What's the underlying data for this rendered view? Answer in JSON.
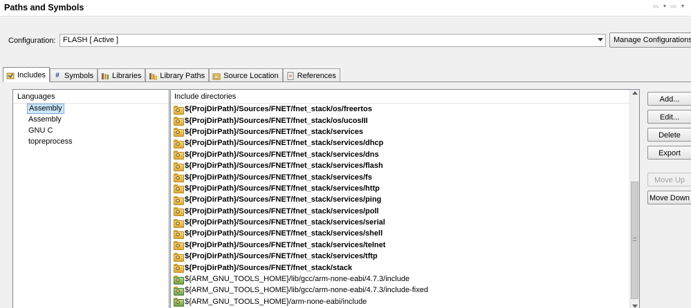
{
  "header": {
    "title": "Paths and Symbols",
    "back_icon": "back-arrow-icon",
    "forward_icon": "forward-arrow-icon"
  },
  "configuration": {
    "label": "Configuration:",
    "selected": "FLASH  [ Active ]",
    "manage_label": "Manage Configurations..."
  },
  "tabs": [
    {
      "label": "Includes",
      "icon": "includes-icon",
      "active": true
    },
    {
      "label": "Symbols",
      "icon": "hash-icon"
    },
    {
      "label": "Libraries",
      "icon": "libraries-icon"
    },
    {
      "label": "Library Paths",
      "icon": "library-paths-icon"
    },
    {
      "label": "Source Location",
      "icon": "source-location-icon"
    },
    {
      "label": "References",
      "icon": "references-icon"
    }
  ],
  "languages": {
    "header": "Languages",
    "items": [
      {
        "label": "Assembly",
        "selected": true
      },
      {
        "label": "Assembly"
      },
      {
        "label": "GNU C"
      },
      {
        "label": "topreprocess"
      }
    ]
  },
  "include_dirs": {
    "header": "Include directories",
    "rows": [
      {
        "path": "${ProjDirPath}/Sources/FNET/fnet_stack/os/freertos",
        "bold": true
      },
      {
        "path": "${ProjDirPath}/Sources/FNET/fnet_stack/os/ucosIII",
        "bold": true
      },
      {
        "path": "${ProjDirPath}/Sources/FNET/fnet_stack/services",
        "bold": true
      },
      {
        "path": "${ProjDirPath}/Sources/FNET/fnet_stack/services/dhcp",
        "bold": true
      },
      {
        "path": "${ProjDirPath}/Sources/FNET/fnet_stack/services/dns",
        "bold": true
      },
      {
        "path": "${ProjDirPath}/Sources/FNET/fnet_stack/services/flash",
        "bold": true
      },
      {
        "path": "${ProjDirPath}/Sources/FNET/fnet_stack/services/fs",
        "bold": true
      },
      {
        "path": "${ProjDirPath}/Sources/FNET/fnet_stack/services/http",
        "bold": true
      },
      {
        "path": "${ProjDirPath}/Sources/FNET/fnet_stack/services/ping",
        "bold": true
      },
      {
        "path": "${ProjDirPath}/Sources/FNET/fnet_stack/services/poll",
        "bold": true
      },
      {
        "path": "${ProjDirPath}/Sources/FNET/fnet_stack/services/serial",
        "bold": true
      },
      {
        "path": "${ProjDirPath}/Sources/FNET/fnet_stack/services/shell",
        "bold": true
      },
      {
        "path": "${ProjDirPath}/Sources/FNET/fnet_stack/services/telnet",
        "bold": true
      },
      {
        "path": "${ProjDirPath}/Sources/FNET/fnet_stack/services/tftp",
        "bold": true
      },
      {
        "path": "${ProjDirPath}/Sources/FNET/fnet_stack/stack",
        "bold": true
      },
      {
        "path": "${ARM_GNU_TOOLS_HOME}/lib/gcc/arm-none-eabi/4.7.3/include",
        "bold": false
      },
      {
        "path": "${ARM_GNU_TOOLS_HOME}/lib/gcc/arm-none-eabi/4.7.3/include-fixed",
        "bold": false
      },
      {
        "path": "${ARM_GNU_TOOLS_HOME}/arm-none-eabi/include",
        "bold": false
      }
    ]
  },
  "buttons": {
    "add": "Add...",
    "edit": "Edit...",
    "delete": "Delete",
    "export": "Export",
    "move_up": "Move Up",
    "move_down": "Move Down"
  },
  "colors": {
    "selection": "#cce8ff",
    "folder": "#f6d77a",
    "workspace_folder": "#b7d98e"
  }
}
